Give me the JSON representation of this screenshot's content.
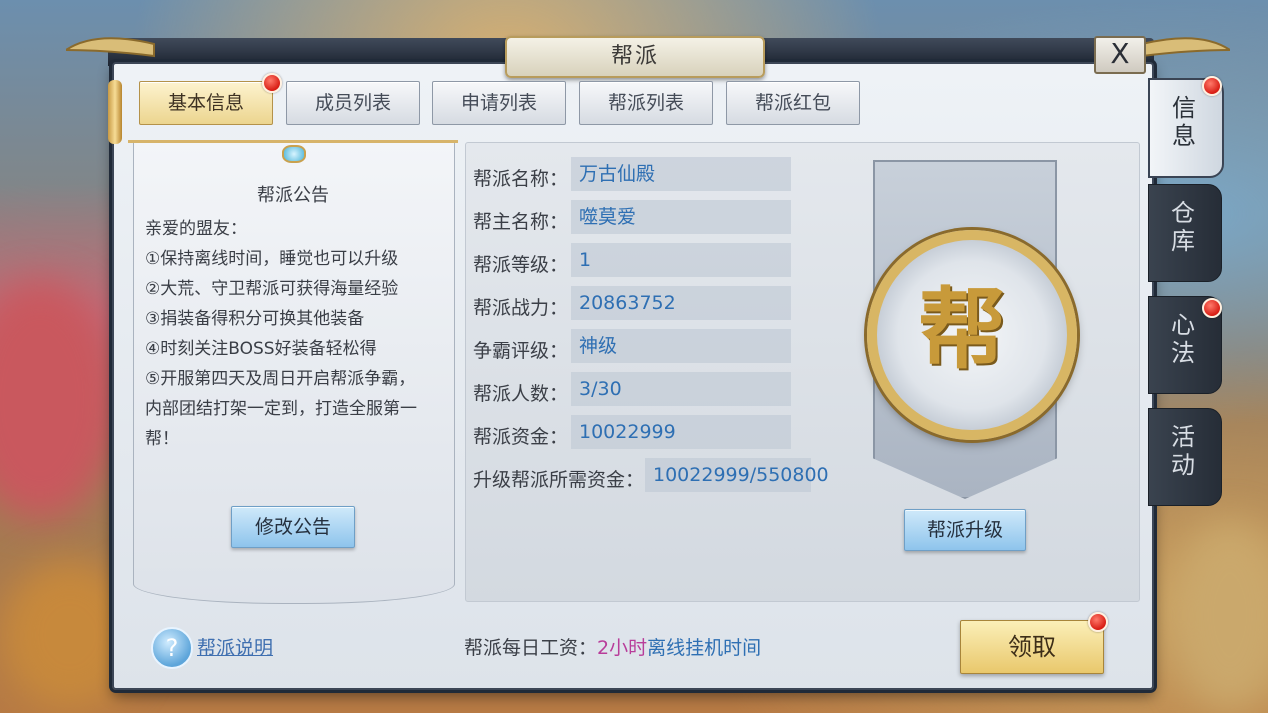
{
  "window": {
    "title": "帮派",
    "close_label": "X"
  },
  "tabs": [
    {
      "label": "基本信息",
      "active": true,
      "badge": true
    },
    {
      "label": "成员列表",
      "active": false,
      "badge": false
    },
    {
      "label": "申请列表",
      "active": false,
      "badge": false
    },
    {
      "label": "帮派列表",
      "active": false,
      "badge": false
    },
    {
      "label": "帮派红包",
      "active": false,
      "badge": false
    }
  ],
  "side_tabs": [
    {
      "label": "信息",
      "active": true,
      "badge": true
    },
    {
      "label": "仓库",
      "active": false,
      "badge": false
    },
    {
      "label": "心法",
      "active": false,
      "badge": true
    },
    {
      "label": "活动",
      "active": false,
      "badge": false
    }
  ],
  "notice": {
    "title": "帮派公告",
    "lines": [
      "亲爱的盟友：",
      "①保持离线时间，睡觉也可以升级",
      "②大荒、守卫帮派可获得海量经验",
      "③捐装备得积分可换其他装备",
      "④时刻关注BOSS好装备轻松得",
      "⑤开服第四天及周日开启帮派争霸，",
      "内部团结打架一定到，打造全服第一",
      "帮！"
    ],
    "edit_button": "修改公告"
  },
  "info": {
    "fields": [
      {
        "label": "帮派名称：",
        "value": "万古仙殿"
      },
      {
        "label": "帮主名称：",
        "value": "噬莫爱"
      },
      {
        "label": "帮派等级：",
        "value": "1"
      },
      {
        "label": "帮派战力：",
        "value": "20863752"
      },
      {
        "label": "争霸评级：",
        "value": "神级"
      },
      {
        "label": "帮派人数：",
        "value": "3/30"
      },
      {
        "label": "帮派资金：",
        "value": "10022999"
      }
    ],
    "upgrade_cost": {
      "label": "升级帮派所需资金：",
      "value": "10022999/550800"
    },
    "emblem_char": "帮",
    "upgrade_button": "帮派升级"
  },
  "footer": {
    "help_icon": "?",
    "help_link": "帮派说明",
    "wage_prefix": "帮派每日工资：",
    "wage_amount": "2小时",
    "wage_suffix": "离线挂机时间",
    "claim_button": "领取",
    "claim_badge": true
  },
  "colors": {
    "accent_gold": "#ecd58f",
    "value_blue": "#2e6fb3",
    "badge_red": "#d81d14",
    "highlight_purple": "#b83d9a"
  }
}
